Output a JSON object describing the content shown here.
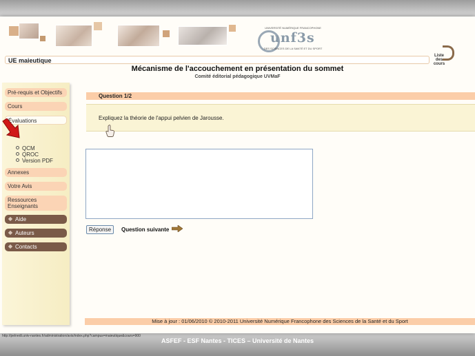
{
  "header": {
    "logo": {
      "line1": "UNIVERSITÉ NUMÉRIQUE FRANCOPHONE",
      "brand": "unf3s",
      "line2": "DES SCIENCES DE LA SANTÉ ET DU SPORT"
    },
    "course_label": "UE maieutique",
    "course_list_label": "Liste des cours",
    "title": "Mécanisme de l'accouchement en présentation du sommet",
    "subtitle": "Comité éditorial pédagogique UVMaF"
  },
  "sidebar": {
    "items": [
      {
        "label": "Pré-requis et Objectifs"
      },
      {
        "label": "Cours"
      },
      {
        "label": "Évaluations"
      },
      {
        "label": "Annexes"
      },
      {
        "label": "Votre Avis"
      },
      {
        "label": "Ressources Enseignants"
      },
      {
        "label": "Aide"
      },
      {
        "label": "Auteurs"
      },
      {
        "label": "Contacts"
      }
    ],
    "evaluations_sub": [
      "QCM",
      "QROC",
      "Version PDF"
    ]
  },
  "main": {
    "question_header": "Question 1/2",
    "question_text": "Expliquez la théorie de l'appui pelvien de Jarousse.",
    "answer_value": "",
    "submit_label": "Réponse",
    "next_label": "Question suivante"
  },
  "footer": {
    "text": "Mise à jour : 01/06/2010 © 2010-2011 Université Numérique Francophone des Sciences de la Santé et du Sport"
  },
  "status_bar": {
    "url": "http://pelnedt.univ-nantes.fr/administration/avis/index.php?campus=maieutique&cours=900"
  },
  "caption": "ASFEF - ESF Nantes - TICES – Université de Nantes",
  "colors": {
    "peach": "#fbcda8",
    "cream": "#faf4d5",
    "brown_button": "#7a5a48",
    "red_arrow": "#d01818"
  }
}
